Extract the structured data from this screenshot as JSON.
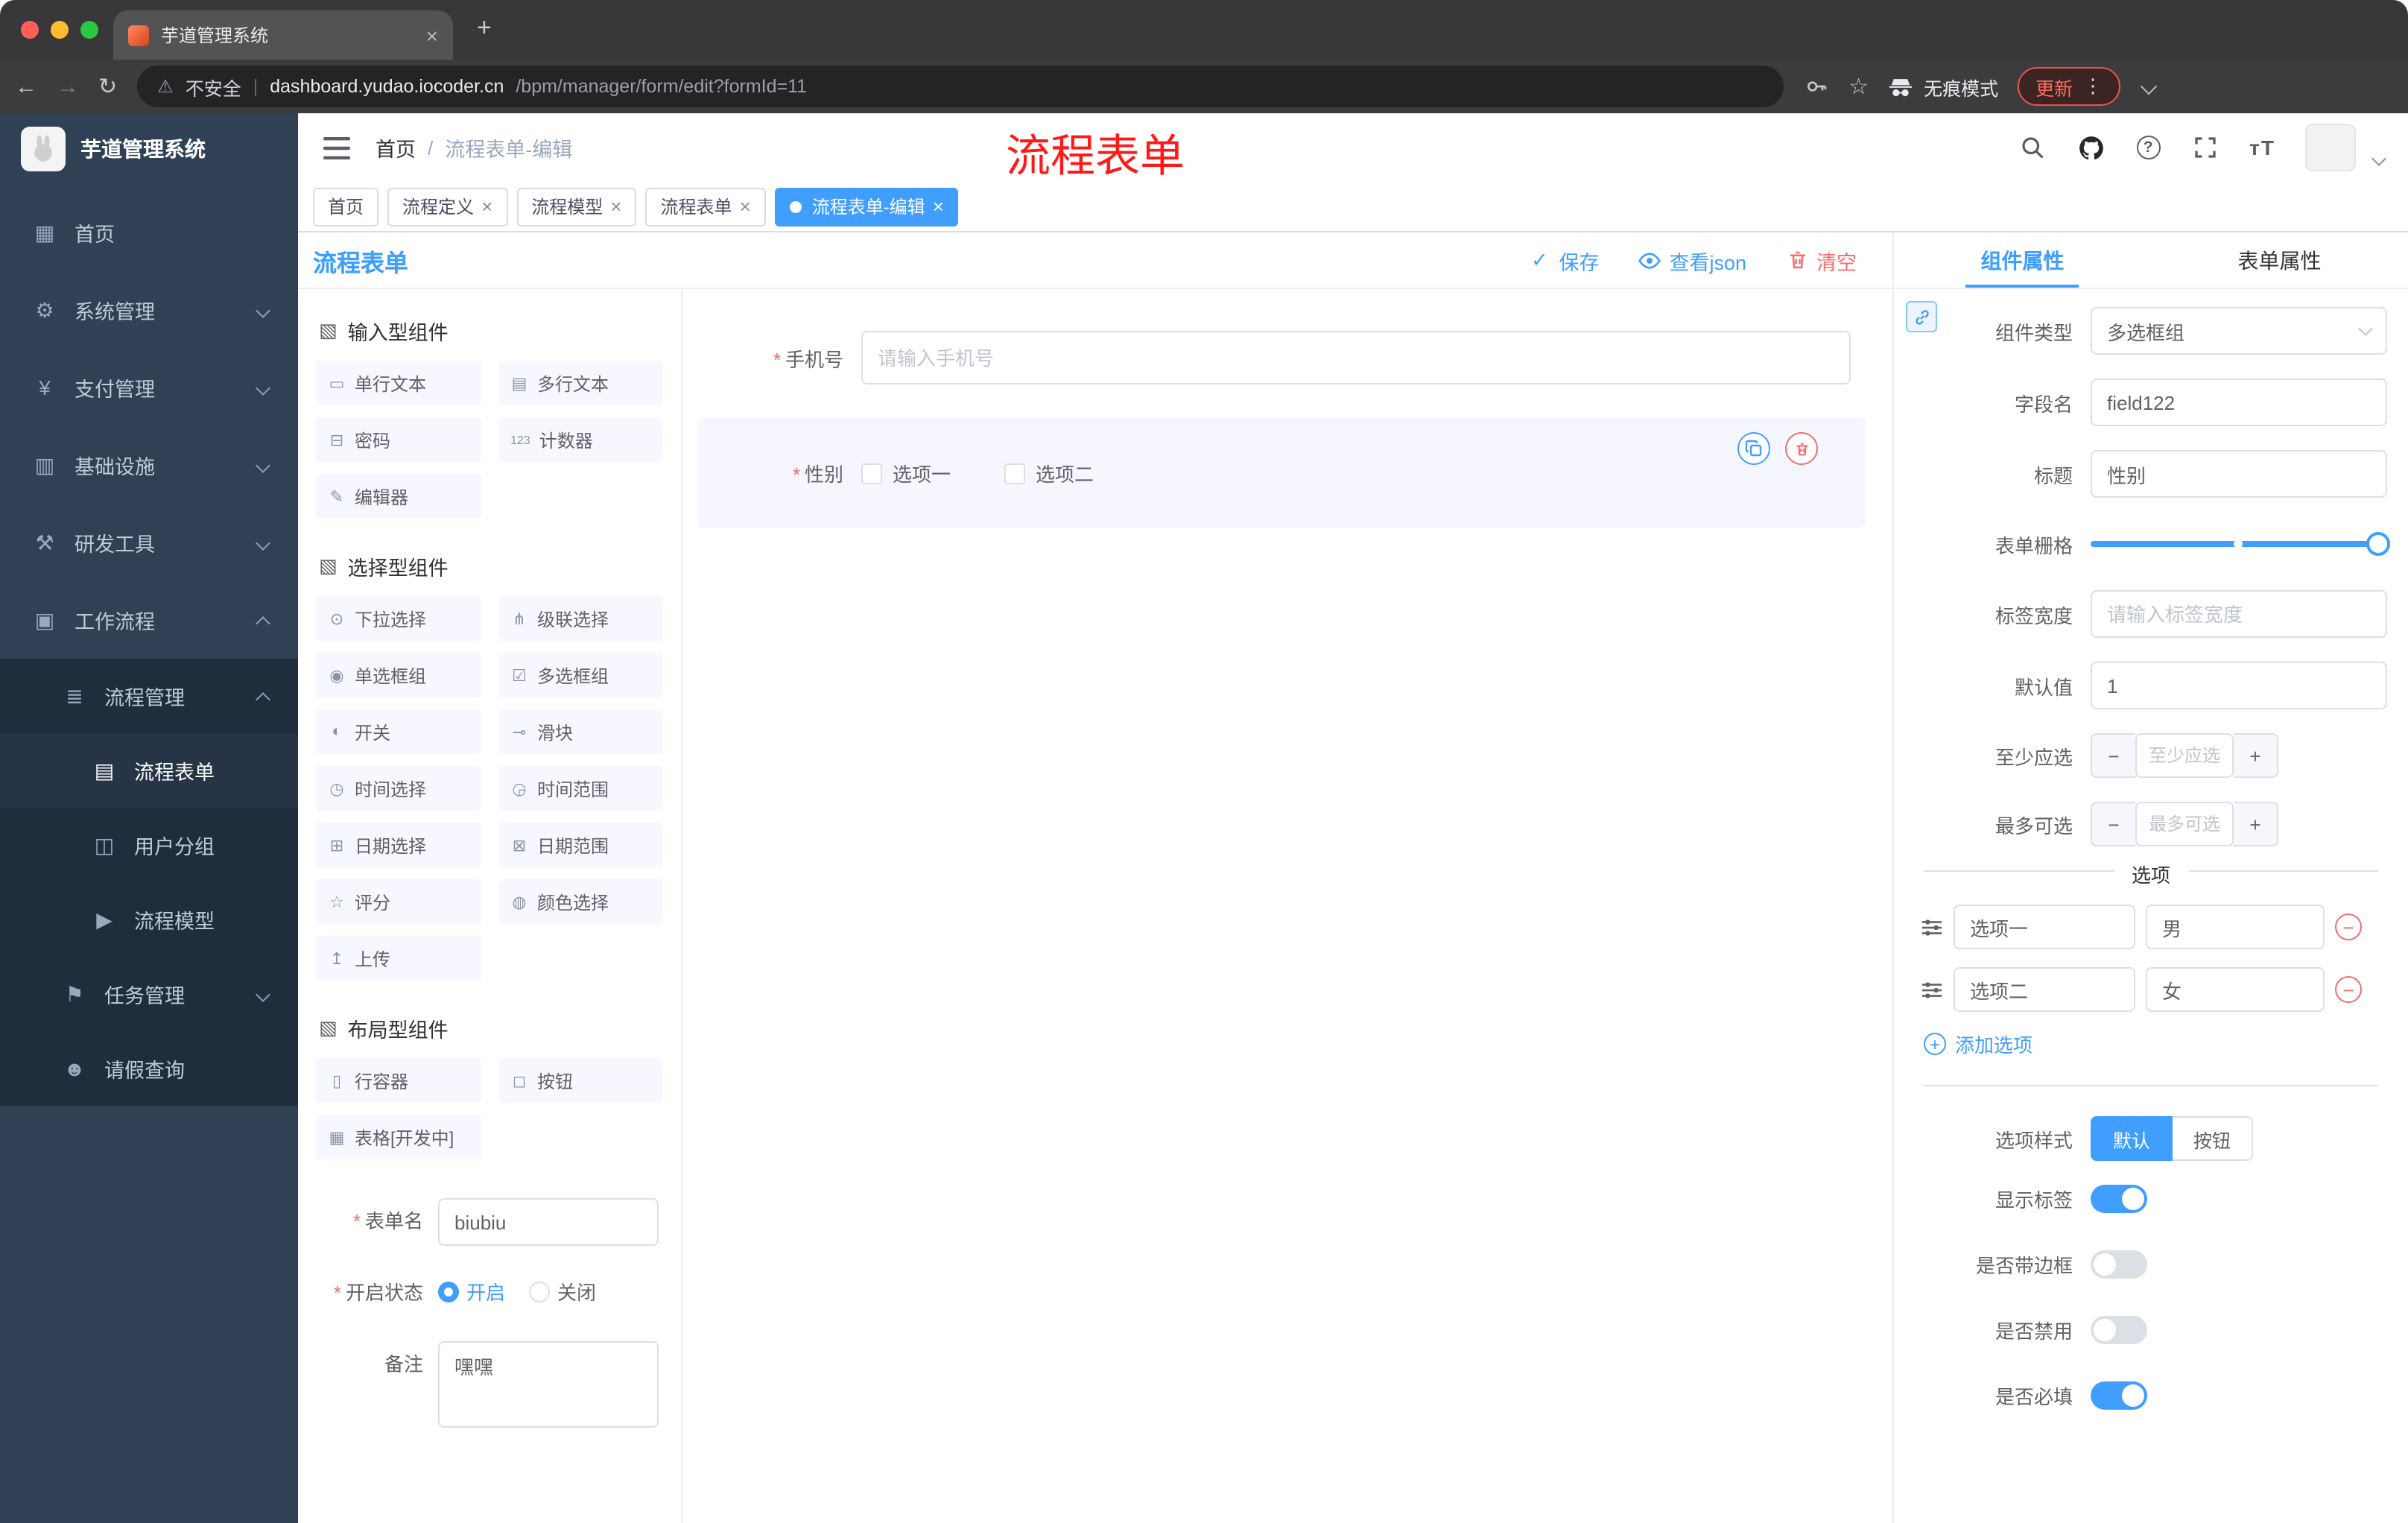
{
  "icons": {
    "close": "×",
    "plus": "+",
    "minus": "−",
    "more": "⋮",
    "check": "✓",
    "back": "←",
    "forward": "→",
    "reload": "↻",
    "star": "☆",
    "warning": "⚠",
    "question": "?",
    "font_size": "тT",
    "slash": "/",
    "pipe": "|"
  },
  "browser": {
    "tab_title": "芋道管理系统",
    "security_label": "不安全",
    "url_host": "dashboard.yudao.iocoder.cn",
    "url_path": "/bpm/manager/form/edit?formId=11",
    "incognito_label": "无痕模式",
    "update_label": "更新"
  },
  "sidebar": {
    "logo_title": "芋道管理系统",
    "items": [
      {
        "label": "首页",
        "glyph": "▦"
      },
      {
        "label": "系统管理",
        "glyph": "⚙"
      },
      {
        "label": "支付管理",
        "glyph": "¥"
      },
      {
        "label": "基础设施",
        "glyph": "▥"
      },
      {
        "label": "研发工具",
        "glyph": "⚒"
      },
      {
        "label": "工作流程",
        "glyph": "▣"
      },
      {
        "label": "流程管理",
        "glyph": "≣"
      },
      {
        "label": "流程表单",
        "glyph": "▤"
      },
      {
        "label": "用户分组",
        "glyph": "◫"
      },
      {
        "label": "流程模型",
        "glyph": "▶"
      },
      {
        "label": "任务管理",
        "glyph": "⚑"
      },
      {
        "label": "请假查询",
        "glyph": "☻"
      }
    ]
  },
  "header": {
    "breadcrumb_home": "首页",
    "breadcrumb_separator": "/",
    "breadcrumb_current": "流程表单-编辑",
    "annotation": "流程表单"
  },
  "tags": [
    {
      "label": "首页"
    },
    {
      "label": "流程定义"
    },
    {
      "label": "流程模型"
    },
    {
      "label": "流程表单"
    },
    {
      "label": "流程表单-编辑"
    }
  ],
  "toolbar": {
    "title": "流程表单",
    "save": "保存",
    "view_json": "查看json",
    "clear": "清空"
  },
  "components": {
    "groups": [
      {
        "title": "输入型组件",
        "glyph": "▧",
        "items": [
          {
            "label": "单行文本",
            "glyph": "▭"
          },
          {
            "label": "多行文本",
            "glyph": "▤"
          },
          {
            "label": "密码",
            "glyph": "⊟"
          },
          {
            "label": "计数器",
            "glyph": "123"
          },
          {
            "label": "编辑器",
            "glyph": "✎"
          }
        ]
      },
      {
        "title": "选择型组件",
        "glyph": "▧",
        "items": [
          {
            "label": "下拉选择",
            "glyph": "⊙"
          },
          {
            "label": "级联选择",
            "glyph": "⋔"
          },
          {
            "label": "单选框组",
            "glyph": "◉"
          },
          {
            "label": "多选框组",
            "glyph": "☑"
          },
          {
            "label": "开关",
            "glyph": "◐"
          },
          {
            "label": "滑块",
            "glyph": "⊸"
          },
          {
            "label": "时间选择",
            "glyph": "◷"
          },
          {
            "label": "时间范围",
            "glyph": "◶"
          },
          {
            "label": "日期选择",
            "glyph": "⊞"
          },
          {
            "label": "日期范围",
            "glyph": "⊠"
          },
          {
            "label": "评分",
            "glyph": "☆"
          },
          {
            "label": "颜色选择",
            "glyph": "◍"
          },
          {
            "label": "上传",
            "glyph": "↥"
          }
        ]
      },
      {
        "title": "布局型组件",
        "glyph": "▧",
        "items": [
          {
            "label": "行容器",
            "glyph": "▯"
          },
          {
            "label": "按钮",
            "glyph": "◻"
          },
          {
            "label": "表格[开发中]",
            "glyph": "▦"
          }
        ]
      }
    ]
  },
  "form_settings": {
    "name_label": "表单名",
    "name_value": "biubiu",
    "status_label": "开启状态",
    "status_on": "开启",
    "status_off": "关闭",
    "remark_label": "备注",
    "remark_value": "嘿嘿"
  },
  "canvas": {
    "phone_label": "手机号",
    "phone_placeholder": "请输入手机号",
    "gender_label": "性别",
    "gender_options": [
      {
        "label": "选项一"
      },
      {
        "label": "选项二"
      }
    ]
  },
  "properties": {
    "tab_component": "组件属性",
    "tab_form": "表单属性",
    "component_type_label": "组件类型",
    "component_type_value": "多选框组",
    "field_name_label": "字段名",
    "field_name_value": "field122",
    "title_label": "标题",
    "title_value": "性别",
    "grid_label": "表单栅格",
    "label_width_label": "标签宽度",
    "label_width_placeholder": "请输入标签宽度",
    "default_label": "默认值",
    "default_value": "1",
    "min_label": "至少应选",
    "min_placeholder": "至少应选",
    "max_label": "最多可选",
    "max_placeholder": "最多可选",
    "options_divider": "选项",
    "options": [
      {
        "label": "选项一",
        "value": "男"
      },
      {
        "label": "选项二",
        "value": "女"
      }
    ],
    "add_option": "添加选项",
    "style_label": "选项样式",
    "style_default": "默认",
    "style_button": "按钮",
    "toggles": [
      {
        "label": "显示标签",
        "on": true
      },
      {
        "label": "是否带边框",
        "on": false
      },
      {
        "label": "是否禁用",
        "on": false
      },
      {
        "label": "是否必填",
        "on": true
      }
    ]
  },
  "colors": {
    "accent": "#409eff",
    "danger": "#f56c6c",
    "sidebar": "#304156"
  }
}
